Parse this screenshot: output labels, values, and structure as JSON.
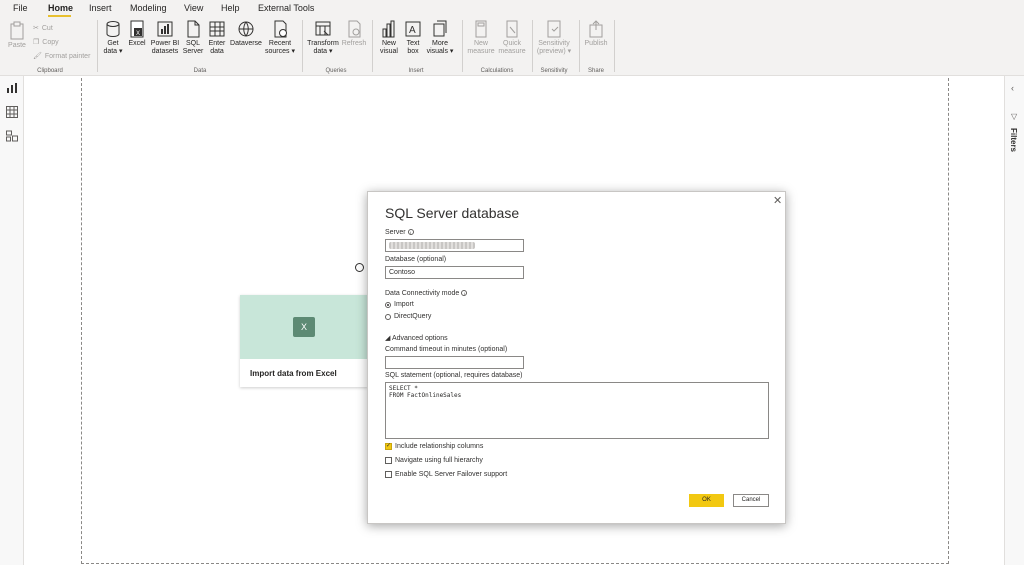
{
  "menu": {
    "items": [
      "File",
      "Home",
      "Insert",
      "Modeling",
      "View",
      "Help",
      "External Tools"
    ],
    "active": "Home"
  },
  "ribbon": {
    "clipboard": {
      "paste": "Paste",
      "cut": "Cut",
      "copy": "Copy",
      "format_painter": "Format painter",
      "group": "Clipboard"
    },
    "data": {
      "get_data": [
        "Get",
        "data ▾"
      ],
      "excel": [
        "Excel"
      ],
      "power_bi": [
        "Power BI",
        "datasets"
      ],
      "sql_server": [
        "SQL",
        "Server"
      ],
      "enter_data": [
        "Enter",
        "data"
      ],
      "dataverse": [
        "Dataverse"
      ],
      "recent_sources": [
        "Recent",
        "sources ▾"
      ],
      "group": "Data"
    },
    "queries": {
      "transform": [
        "Transform",
        "data ▾"
      ],
      "refresh": [
        "Refresh"
      ],
      "group": "Queries"
    },
    "insert": {
      "new_visual": [
        "New",
        "visual"
      ],
      "text_box": [
        "Text",
        "box"
      ],
      "more_visuals": [
        "More",
        "visuals ▾"
      ],
      "group": "Insert"
    },
    "calculations": {
      "new_measure": [
        "New",
        "measure"
      ],
      "quick_measure": [
        "Quick",
        "measure"
      ],
      "group": "Calculations"
    },
    "sensitivity": {
      "label": [
        "Sensitivity",
        "(preview) ▾"
      ],
      "group": "Sensitivity"
    },
    "share": {
      "publish": [
        "Publish"
      ],
      "group": "Share"
    }
  },
  "right_pane": {
    "filters": "Filters"
  },
  "canvas": {
    "import_card_label": "Import data from Excel",
    "excel_glyph": "X"
  },
  "dialog": {
    "title": "SQL Server database",
    "close": "✕",
    "server_label": "Server",
    "database_label": "Database (optional)",
    "database_value": "Contoso",
    "connectivity_label": "Data Connectivity mode",
    "mode_import": "Import",
    "mode_directquery": "DirectQuery",
    "mode_selected": "Import",
    "advanced_label": "◢ Advanced options",
    "timeout_label": "Command timeout in minutes (optional)",
    "timeout_value": "",
    "sql_label": "SQL statement (optional, requires database)",
    "sql_value": "SELECT *\nFROM FactOnlineSales",
    "cb_relationship": "Include relationship columns",
    "cb_relationship_checked": true,
    "cb_hierarchy": "Navigate using full hierarchy",
    "cb_hierarchy_checked": false,
    "cb_failover": "Enable SQL Server Failover support",
    "cb_failover_checked": false,
    "ok_label": "OK",
    "cancel_label": "Cancel"
  },
  "colors": {
    "accent": "#f2c811",
    "excel_card": "#c8e6d9"
  }
}
